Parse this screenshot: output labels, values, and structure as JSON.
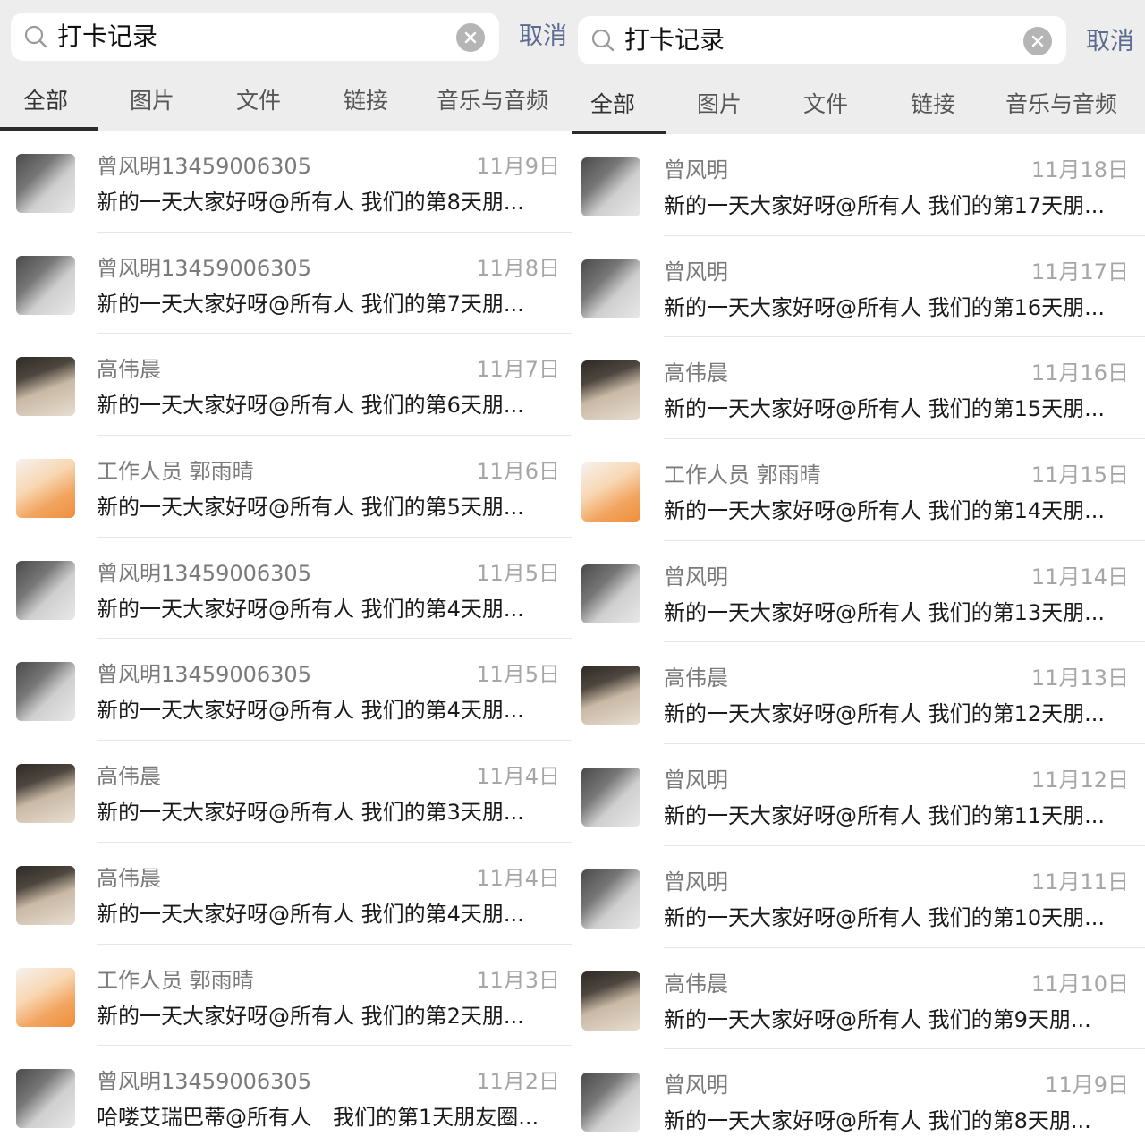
{
  "left": {
    "search": {
      "query": "打卡记录",
      "cancel_label": "取消"
    },
    "tabs": [
      "全部",
      "图片",
      "文件",
      "链接",
      "音乐与音频"
    ],
    "items": [
      {
        "name": "曾风明13459006305",
        "date": "11月9日",
        "message": "新的一天大家好呀@所有人 我们的第8天朋...",
        "avatar": "zeng"
      },
      {
        "name": "曾风明13459006305",
        "date": "11月8日",
        "message": "新的一天大家好呀@所有人 我们的第7天朋...",
        "avatar": "zeng"
      },
      {
        "name": "高伟晨",
        "date": "11月7日",
        "message": "新的一天大家好呀@所有人 我们的第6天朋...",
        "avatar": "gao"
      },
      {
        "name": "工作人员 郭雨晴",
        "date": "11月6日",
        "message": "新的一天大家好呀@所有人 我们的第5天朋...",
        "avatar": "guo"
      },
      {
        "name": "曾风明13459006305",
        "date": "11月5日",
        "message": "新的一天大家好呀@所有人 我们的第4天朋...",
        "avatar": "zeng"
      },
      {
        "name": "曾风明13459006305",
        "date": "11月5日",
        "message": "新的一天大家好呀@所有人 我们的第4天朋...",
        "avatar": "zeng"
      },
      {
        "name": "高伟晨",
        "date": "11月4日",
        "message": "新的一天大家好呀@所有人 我们的第3天朋...",
        "avatar": "gao"
      },
      {
        "name": "高伟晨",
        "date": "11月4日",
        "message": "新的一天大家好呀@所有人 我们的第4天朋...",
        "avatar": "gao"
      },
      {
        "name": "工作人员 郭雨晴",
        "date": "11月3日",
        "message": "新的一天大家好呀@所有人 我们的第2天朋...",
        "avatar": "guo"
      },
      {
        "name": "曾风明13459006305",
        "date": "11月2日",
        "message": "哈喽艾瑞巴蒂@所有人　我们的第1天朋友圈...",
        "avatar": "zeng"
      }
    ]
  },
  "right": {
    "search": {
      "query": "打卡记录",
      "cancel_label": "取消"
    },
    "tabs": [
      "全部",
      "图片",
      "文件",
      "链接",
      "音乐与音频"
    ],
    "items": [
      {
        "name": "曾风明",
        "date": "11月18日",
        "message": "新的一天大家好呀@所有人 我们的第17天朋...",
        "avatar": "zeng"
      },
      {
        "name": "曾风明",
        "date": "11月17日",
        "message": "新的一天大家好呀@所有人 我们的第16天朋...",
        "avatar": "zeng"
      },
      {
        "name": "高伟晨",
        "date": "11月16日",
        "message": "新的一天大家好呀@所有人 我们的第15天朋...",
        "avatar": "gao"
      },
      {
        "name": "工作人员 郭雨晴",
        "date": "11月15日",
        "message": "新的一天大家好呀@所有人 我们的第14天朋...",
        "avatar": "guo"
      },
      {
        "name": "曾风明",
        "date": "11月14日",
        "message": "新的一天大家好呀@所有人 我们的第13天朋...",
        "avatar": "zeng"
      },
      {
        "name": "高伟晨",
        "date": "11月13日",
        "message": "新的一天大家好呀@所有人 我们的第12天朋...",
        "avatar": "gao"
      },
      {
        "name": "曾风明",
        "date": "11月12日",
        "message": "新的一天大家好呀@所有人 我们的第11天朋...",
        "avatar": "zeng"
      },
      {
        "name": "曾风明",
        "date": "11月11日",
        "message": "新的一天大家好呀@所有人 我们的第10天朋...",
        "avatar": "zeng"
      },
      {
        "name": "高伟晨",
        "date": "11月10日",
        "message": "新的一天大家好呀@所有人 我们的第9天朋...",
        "avatar": "gao"
      },
      {
        "name": "曾风明",
        "date": "11月9日",
        "message": "新的一天大家好呀@所有人 我们的第8天朋...",
        "avatar": "zeng"
      }
    ]
  }
}
